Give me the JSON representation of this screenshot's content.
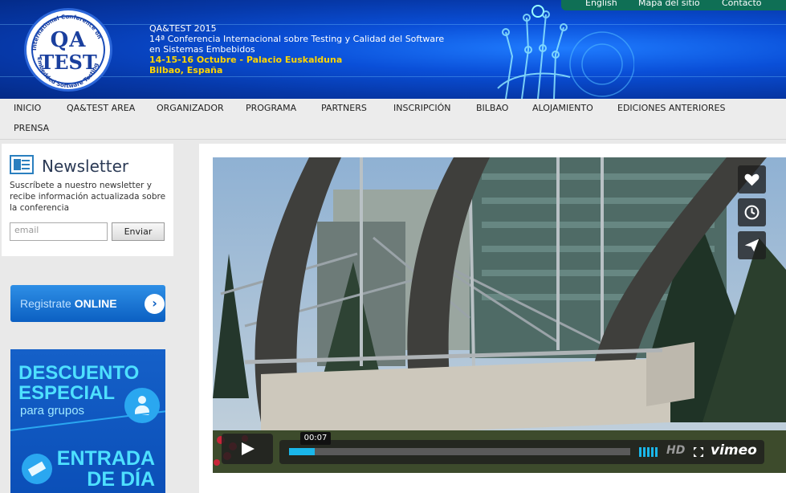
{
  "header": {
    "logo": {
      "top": "QA",
      "bottom": "TEST",
      "ring_top": "International Conference on",
      "ring_bottom": "Embedded Software Testing"
    },
    "line1": "QA&TEST 2015",
    "line2": "14ª Conferencia Internacional sobre Testing y Calidad del Software",
    "line3": "en Sistemas Embebidos",
    "line4": "14-15-16 Octubre - Palacio Euskalduna",
    "line5": "Bilbao, España",
    "toplinks": [
      "English",
      "Mapa del sitio",
      "Contacto"
    ]
  },
  "nav": {
    "items": [
      "INICIO",
      "QA&TEST AREA",
      "ORGANIZADOR",
      "PROGRAMA",
      "PARTNERS",
      "INSCRIPCIÓN",
      "BILBAO",
      "ALOJAMIENTO",
      "EDICIONES ANTERIORES",
      "PRENSA"
    ]
  },
  "sidebar": {
    "newsletter": {
      "title": "Newsletter",
      "description": "Suscríbete a nuestro newsletter y recibe información actualizada sobre la conferencia",
      "email_placeholder": "email",
      "submit_label": "Enviar"
    },
    "register": {
      "prefix": "Registrate ",
      "emphasis": "ONLINE",
      "arrow": "›"
    },
    "promo": {
      "line1": "DESCUENTO",
      "line2": "ESPECIAL",
      "line3": "para grupos",
      "line4": "ENTRADA",
      "line5": "DE DÍA"
    }
  },
  "video": {
    "time": "00:07",
    "progress": 0.075,
    "hd_label": "HD",
    "brand": "vimeo",
    "side_icons": [
      "heart-icon",
      "clock-icon",
      "send-icon"
    ]
  },
  "colors": {
    "header_blue": "#0a4fd8",
    "accent_yellow": "#ffd500",
    "vimeo_blue": "#1ab7ea",
    "topbar_green": "#0f6f55"
  }
}
